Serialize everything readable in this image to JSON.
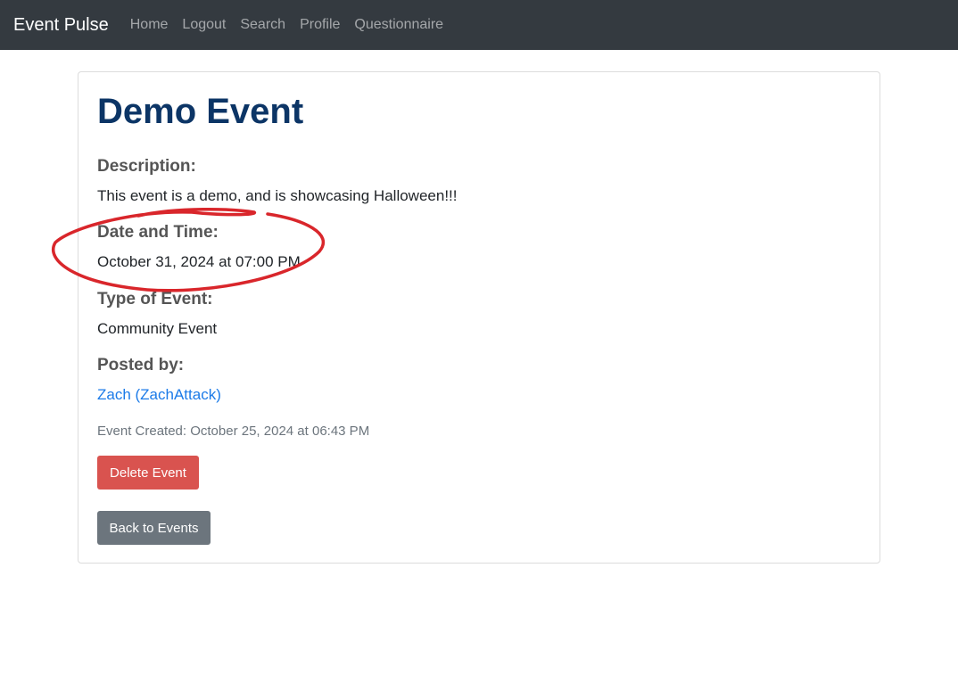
{
  "nav": {
    "brand": "Event Pulse",
    "links": [
      "Home",
      "Logout",
      "Search",
      "Profile",
      "Questionnaire"
    ]
  },
  "event": {
    "title": "Demo Event",
    "description_label": "Description:",
    "description": "This event is a demo, and is showcasing Halloween!!!",
    "datetime_label": "Date and Time:",
    "datetime": "October 31, 2024 at 07:00 PM",
    "type_label": "Type of Event:",
    "type": "Community Event",
    "posted_by_label": "Posted by:",
    "posted_by": "Zach (ZachAttack)",
    "created": "Event Created: October 25, 2024 at 06:43 PM"
  },
  "actions": {
    "delete_label": "Delete Event",
    "back_label": "Back to Events"
  },
  "colors": {
    "navbar": "#343a40",
    "title": "#0c3566",
    "link": "#1c7be8",
    "danger": "#d9534f",
    "secondary": "#6c757d",
    "annotation": "#d9262b"
  }
}
